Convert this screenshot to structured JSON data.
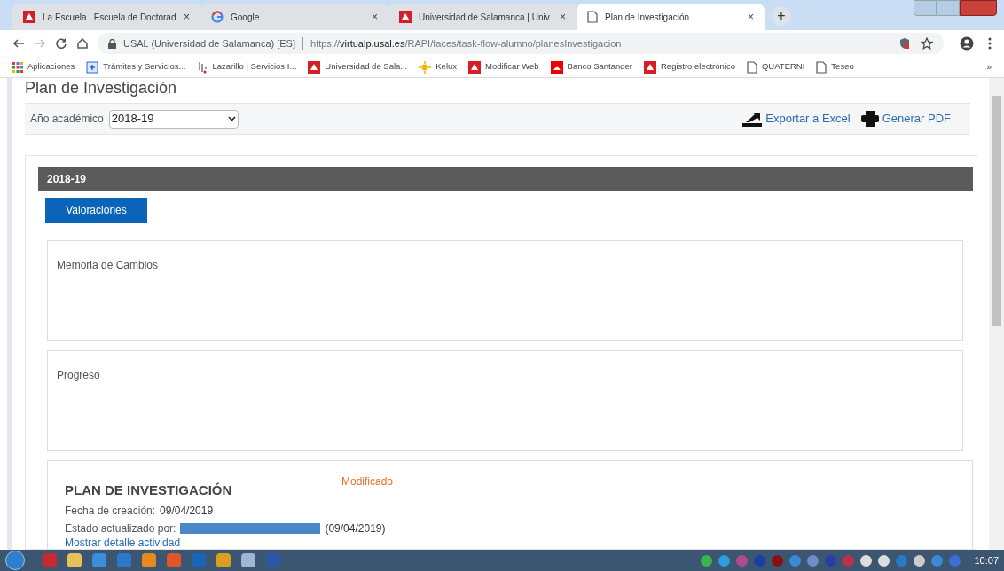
{
  "browser": {
    "tabs": [
      {
        "title": "La Escuela | Escuela de Doctorad",
        "kind": "usal",
        "close": "×",
        "selected": false
      },
      {
        "title": "Google",
        "kind": "google",
        "close": "×",
        "selected": false
      },
      {
        "title": "Universidad de Salamanca | Univ",
        "kind": "usal",
        "close": "×",
        "selected": false
      },
      {
        "title": "Plan de Investigación",
        "kind": "page",
        "close": "×",
        "selected": true
      }
    ],
    "new_tab": "+",
    "address": {
      "site": "USAL (Universidad de Salamanca) [ES]",
      "url_prefix": "https://",
      "url_host": "virtualp.usal.es",
      "url_path": "/RAPI/faces/task-flow-alumno/planesInvestigacion"
    },
    "bookmarks": [
      {
        "label": "Aplicaciones",
        "kind": "apps"
      },
      {
        "label": "Trámites y Servicios...",
        "kind": "blue"
      },
      {
        "label": "Lazarillo | Servicios I...",
        "kind": "lazarillo"
      },
      {
        "label": "Universidad de Sala...",
        "kind": "usal"
      },
      {
        "label": "Kelux",
        "kind": "star"
      },
      {
        "label": "Modificar Web",
        "kind": "usal"
      },
      {
        "label": "Banco Santander",
        "kind": "santander"
      },
      {
        "label": "Registro electrónico",
        "kind": "usal"
      },
      {
        "label": "QUATERNI",
        "kind": "page"
      },
      {
        "label": "Teseo",
        "kind": "page"
      }
    ],
    "more": "»"
  },
  "page": {
    "heading": "Plan de Investigación",
    "year_label": "Año académico",
    "year_value": "2018-19",
    "actions": [
      {
        "label": "Exportar a Excel",
        "kind": "export"
      },
      {
        "label": "Generar PDF",
        "kind": "print"
      }
    ],
    "section_title": "2018-19",
    "section_button": "Valoraciones",
    "panels": [
      "Memoria de Cambios",
      "Progreso"
    ],
    "plan": {
      "title": "PLAN DE INVESTIGACIÓN",
      "status": "Modificado",
      "created_label": "Fecha de creación:",
      "created_value": "09/04/2019",
      "updated_label": "Estado actualizado por:",
      "updated_date": "(09/04/2019)",
      "link": "Mostrar detalle actividad"
    }
  },
  "taskbar": {
    "clock": "10:07"
  }
}
